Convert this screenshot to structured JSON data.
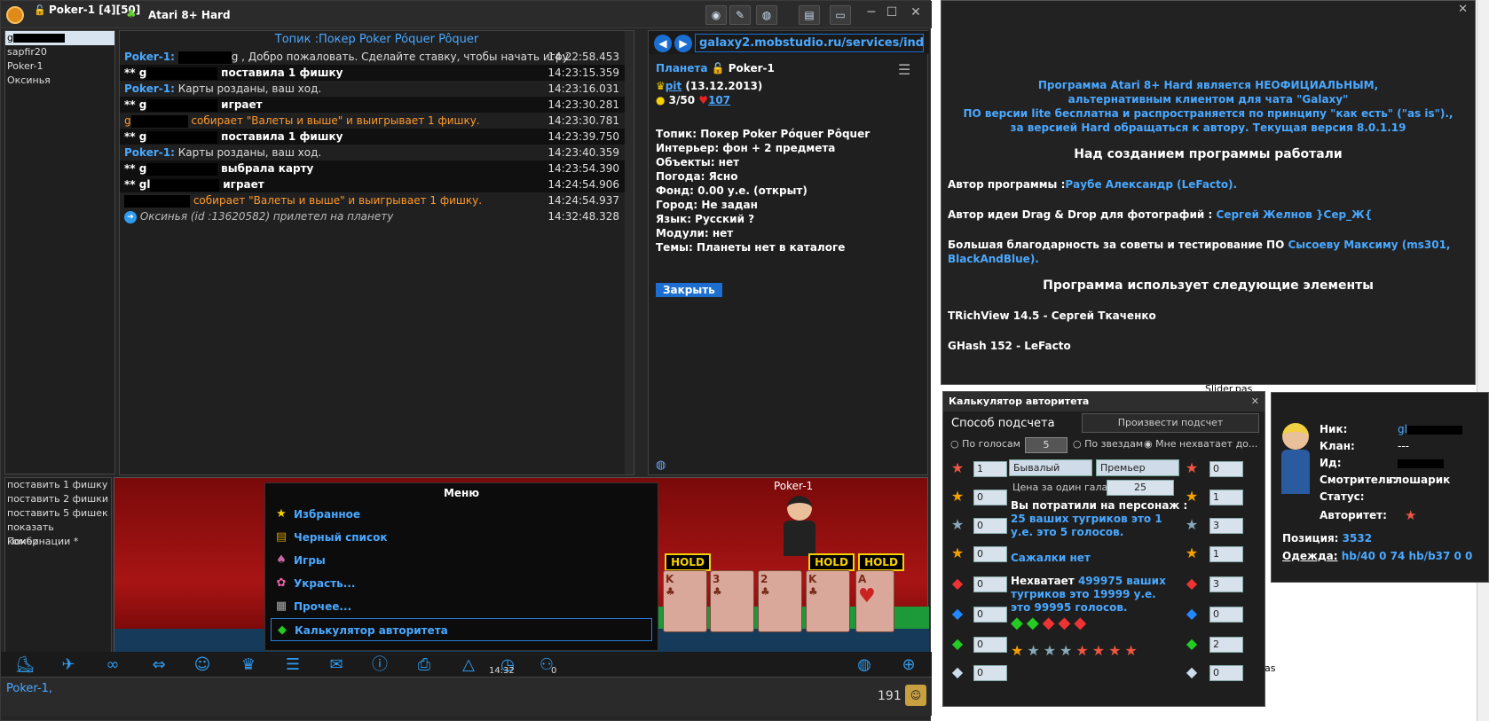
{
  "titlebar": {
    "app_title": "Atari 8+ Hard",
    "window_tab": "Poker-1 [4][50]"
  },
  "users": [
    "g",
    "sapfir20",
    "Poker-1",
    "Оксинья"
  ],
  "commands": [
    "поставить 1 фишку",
    "поставить 2 фишки",
    "поставить 5 фишек",
    "показать комбинации *",
    "Покер"
  ],
  "chat": {
    "topic": "Топик :Покер Poker Póquer Pôquer",
    "messages": [
      {
        "sender": "Poker-1:",
        "text": "g , Добро пожаловать. Сделайте ставку, чтобы начать игру.",
        "time": "14:22:58.453"
      },
      {
        "sender": "** g",
        "text": "поставила 1 фишку",
        "time": "14:23:15.359"
      },
      {
        "sender": "Poker-1:",
        "text": "Карты розданы, ваш ход.",
        "time": "14:23:16.031"
      },
      {
        "sender": "** g",
        "text": "играет",
        "time": "14:23:30.281"
      },
      {
        "sender": "g",
        "text": "собирает \"Валеты и выше\" и выигрывает 1 фишку.",
        "time": "14:23:30.781"
      },
      {
        "sender": "** g",
        "text": "поставила 1 фишку",
        "time": "14:23:39.750"
      },
      {
        "sender": "Poker-1:",
        "text": "Карты розданы, ваш ход.",
        "time": "14:23:40.359"
      },
      {
        "sender": "** g",
        "text": "выбрала карту",
        "time": "14:23:54.390"
      },
      {
        "sender": "** gl",
        "text": "играет",
        "time": "14:24:54.906"
      },
      {
        "sender": "",
        "text": "собирает \"Валеты и выше\" и выигрывает 1 фишку.",
        "time": "14:24:54.937"
      },
      {
        "sender": "",
        "text": "Оксинья (id :13620582) прилетел на планету",
        "time": "14:32:48.328"
      }
    ]
  },
  "info": {
    "url": "galaxy2.mobstudio.ru/services/index.php",
    "planet_label": "Планета",
    "planet_name": "Poker-1",
    "owner": "pit",
    "owner_date": "(13.12.2013)",
    "count": "3/50",
    "hearts": "107",
    "lines": [
      "Топик: Покер Poker Póquer Pôquer",
      "Интерьер: фон + 2 предмета",
      "Объекты: нет",
      "Погода: Ясно",
      "Фонд: 0.00 у.е. (открыт)",
      "Город: Не задан",
      "Язык: Русский ?",
      "Модули: нет",
      "Темы: Планеты нет в каталоге"
    ],
    "close_label": "Закрыть"
  },
  "game": {
    "dealer": "Poker-1",
    "hold": "HOLD"
  },
  "menu": {
    "title": "Меню",
    "items": [
      "Избранное",
      "Черный список",
      "Игры",
      "Украсть...",
      "Прочее...",
      "Калькулятор авторитета"
    ]
  },
  "toolbar": {
    "clock": "14:32",
    "count": "0"
  },
  "input": {
    "value": "Poker-1,",
    "counter": "191"
  },
  "about": {
    "intro": [
      "Программа Atari 8+ Hard является НЕОФИЦИАЛЬНЫМ,",
      "альтернативным клиентом для чата \"Galaxy\"",
      "ПО версии lite бесплатна и распространяется по принципу \"как есть\" (\"as is\").,",
      "за версией Hard обращаться к автору. Текущая версия 8.0.1.19"
    ],
    "heading1": "Над созданием программы работали",
    "author_label": "Автор программы :",
    "author": "Раубе Александр (LeFacto).",
    "dnd_label": "Автор идеи Drag & Drop для фотографий :",
    "dnd": "Сергей Желнов }Сер_Ж{",
    "thanks_label": "Большая благодарность за советы и тестирование ПО",
    "thanks": "Сысоеву Максиму (ms301, BlackAndBlue).",
    "heading2": "Программа использует следующие элементы",
    "lib1": "TRichView 14.5 - Сергей Ткаченко",
    "lib2": "GHash 152 - LeFacto"
  },
  "calc": {
    "title": "Калькулятор авторитета",
    "method": "Способ подсчета",
    "compute": "Произвести подсчет",
    "by_votes": "По голосам",
    "votes_value": "5",
    "by_stars": "По звездам",
    "missing": "Мне нехватает до...",
    "sel1": "Бывалый",
    "sel2": "Премьер галакт",
    "price_label": "Цена за один гала у.е",
    "price": "25",
    "spent_title": "Вы потратили на персонаж :",
    "spent_detail": "25 ваших тугриков это 1 у.е. это 5 голосов.",
    "regrets": "Сажалки нет",
    "need_title": "Нехватает",
    "need_detail": "499975 ваших тугриков это 19999 у.е. это 99995 голосов.",
    "left_vals": [
      "1",
      "0",
      "0",
      "0",
      "0",
      "0",
      "0",
      "0"
    ],
    "right_vals": [
      "0",
      "1",
      "3",
      "1",
      "3",
      "0",
      "2",
      "0"
    ]
  },
  "profile": {
    "nick_label": "Ник:",
    "nick": "gl",
    "clan_label": "Клан:",
    "clan": "---",
    "id_label": "Ид:",
    "watcher_label": "Смотритель:",
    "watcher": "глошарик",
    "status_label": "Статус:",
    "auth_label": "Авторитет:",
    "position_label": "Позиция:",
    "position": "3532",
    "clothes_label": "Одежда:",
    "clothes": "hb/40 0 74  hb/b37 0 0"
  },
  "bg": {
    "file1": "Slider.pas",
    "file2": "pas",
    "file3": "pas"
  }
}
